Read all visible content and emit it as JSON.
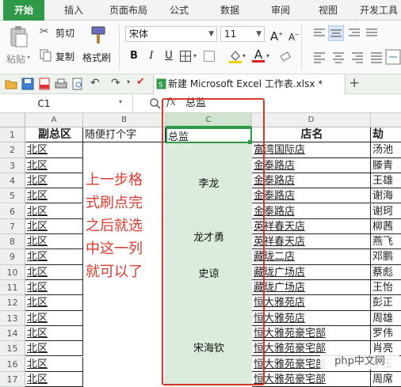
{
  "menu_tabs": [
    "开始",
    "插入",
    "页面布局",
    "公式",
    "数据",
    "审阅",
    "视图",
    "开发工具"
  ],
  "ribbon": {
    "paste_label": "粘贴",
    "cut_label": "剪切",
    "copy_label": "复制",
    "format_painter_label": "格式刷",
    "font_name": "宋体",
    "font_size": "11",
    "bold": "B",
    "italic": "I",
    "underline": "U",
    "font_color_glyph": "A",
    "grow_font_glyph": "A",
    "shrink_font_glyph": "A"
  },
  "file_tab": {
    "title": "新建 Microsoft Excel 工作表.xlsx *"
  },
  "formula_bar": {
    "cell_ref": "C1",
    "fx": "fx",
    "value": "总监"
  },
  "columns": [
    "A",
    "B",
    "C",
    "D"
  ],
  "rows": [
    "1",
    "2",
    "3",
    "4",
    "5",
    "6",
    "7",
    "8",
    "9",
    "10",
    "11",
    "12",
    "13",
    "14",
    "15",
    "16",
    "17"
  ],
  "header_row": {
    "a": "副总区",
    "b": "随便打个字",
    "c": "总监",
    "d": "店名",
    "e": "劫"
  },
  "col_a": [
    "北区",
    "北区",
    "北区",
    "北区",
    "北区",
    "北区",
    "北区",
    "北区",
    "北区",
    "北区",
    "北区",
    "北区",
    "北区",
    "北区",
    "北区",
    "北区"
  ],
  "col_d": [
    "富湾国际店",
    "金泰路店",
    "金泰路店",
    "金泰路店",
    "金泰路店",
    "英祥春天店",
    "英祥春天店",
    "藏珑二店",
    "藏珑广场店",
    "藏珑广场店",
    "恒大雅苑店",
    "恒大雅苑店",
    "恒大雅苑豪宅部",
    "恒大雅苑豪宅部",
    "恒大雅苑豪宅部",
    "恒大雅苑豪宅部"
  ],
  "col_e": [
    "汤池",
    "滕青",
    "王雄",
    "谢海",
    "谢珂",
    "柳茜",
    "燕飞",
    "邓鹏",
    "蔡彪",
    "王怡",
    "彭正",
    "周雄",
    "罗伟",
    "肖亮",
    "李玉",
    "周席"
  ],
  "merged_c": [
    "李龙",
    "龙才勇",
    "史谅",
    "宋海钦"
  ],
  "annotation_lines": [
    "上一步格",
    "式刷点完",
    "之后就选",
    "中这一列",
    "就可以了"
  ],
  "watermark": "php中文网",
  "colors": {
    "accent_green": "#2e9a48",
    "annotation_red": "#e03a2b",
    "selection_green": "#d9ead9"
  }
}
